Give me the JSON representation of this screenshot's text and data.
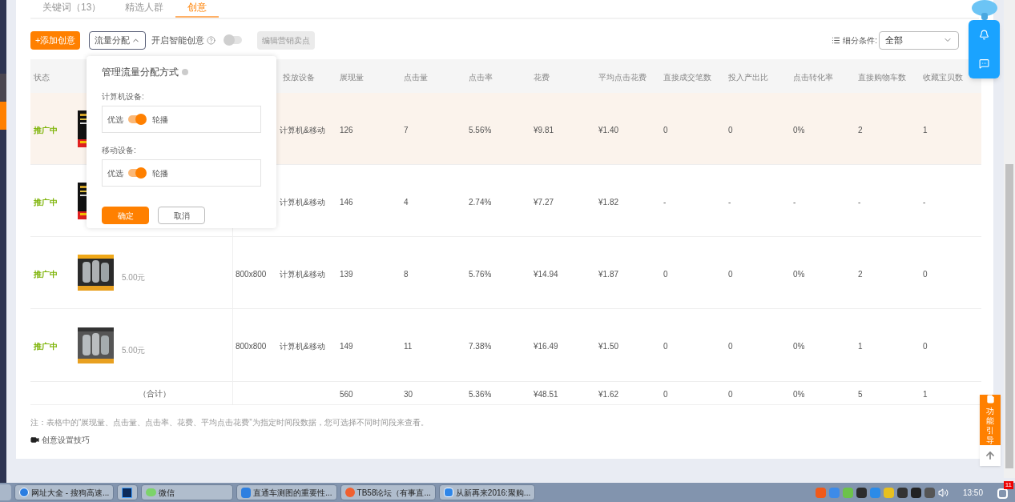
{
  "tabs": [
    {
      "label": "关键词（13）",
      "selected": false
    },
    {
      "label": "精选人群",
      "selected": false
    },
    {
      "label": "创意",
      "selected": true
    }
  ],
  "toolbar": {
    "add_button": "+添加创意",
    "traffic_button": {
      "label": "流量分配",
      "expanded": true
    },
    "smart_creative": {
      "label": "开启智能创意",
      "on": false
    },
    "marketing_button": {
      "label": "编辑营销卖点",
      "disabled": true
    },
    "filter": {
      "label": "细分条件:",
      "value": "全部"
    }
  },
  "table": {
    "columns": [
      "状态",
      "投放设备",
      "展现量",
      "点击量",
      "点击率",
      "花费",
      "平均点击花费",
      "直接成交笔数",
      "投入产出比",
      "点击转化率",
      "直接购物车数",
      "收藏宝贝数"
    ],
    "rows": [
      {
        "status": "推广中",
        "highlighted": true,
        "device": "计算机&移动",
        "metrics": [
          "126",
          "7",
          "5.56%",
          "¥9.81",
          "¥1.40",
          "0",
          "0",
          "0%",
          "2",
          "1"
        ]
      },
      {
        "status": "推广中",
        "highlighted": false,
        "device": "计算机&移动",
        "metrics": [
          "146",
          "4",
          "2.74%",
          "¥7.27",
          "¥1.82",
          "-",
          "-",
          "-",
          "-",
          "-"
        ]
      },
      {
        "status": "推广中",
        "highlighted": false,
        "price": "5.00元",
        "size": "800x800",
        "device": "计算机&移动",
        "metrics": [
          "139",
          "8",
          "5.76%",
          "¥14.94",
          "¥1.87",
          "0",
          "0",
          "0%",
          "2",
          "0"
        ]
      },
      {
        "status": "推广中",
        "highlighted": false,
        "price": "5.00元",
        "size": "800x800",
        "device": "计算机&移动",
        "metrics": [
          "149",
          "11",
          "7.38%",
          "¥16.49",
          "¥1.50",
          "0",
          "0",
          "0%",
          "1",
          "0"
        ]
      }
    ],
    "total": {
      "label": "（合计）",
      "metrics": [
        "560",
        "30",
        "5.36%",
        "¥48.51",
        "¥1.62",
        "0",
        "0",
        "0%",
        "5",
        "1"
      ]
    }
  },
  "popover": {
    "title": "管理流量分配方式",
    "groups": [
      {
        "label": "计算机设备:",
        "left": "优选",
        "right": "轮播",
        "on": true
      },
      {
        "label": "移动设备:",
        "left": "优选",
        "right": "轮播",
        "on": true
      }
    ],
    "buttons": [
      {
        "label": "确定",
        "kind": "primary"
      },
      {
        "label": "取消",
        "kind": "secondary"
      }
    ]
  },
  "note": "注：表格中的“展现量、点击量、点击率、花费、平均点击花费”为指定时间段数据，您可选择不同时间段来查看。",
  "tip_link": "创意设置技巧",
  "guide_button": "功能引导",
  "taskbar": {
    "items": [
      {
        "label": "网址大全 - 搜狗高速...",
        "kind": "browser"
      },
      {
        "kind": "photoshop"
      },
      {
        "label": "微信",
        "kind": "chat"
      },
      {
        "label": "直通车测图的重要性...",
        "kind": "document"
      },
      {
        "label": "TB58论坛（有事直...",
        "kind": "forum"
      },
      {
        "label": "从新再来2016:聚购...",
        "kind": "shield"
      }
    ],
    "clock": "13:50",
    "badge": "11"
  }
}
